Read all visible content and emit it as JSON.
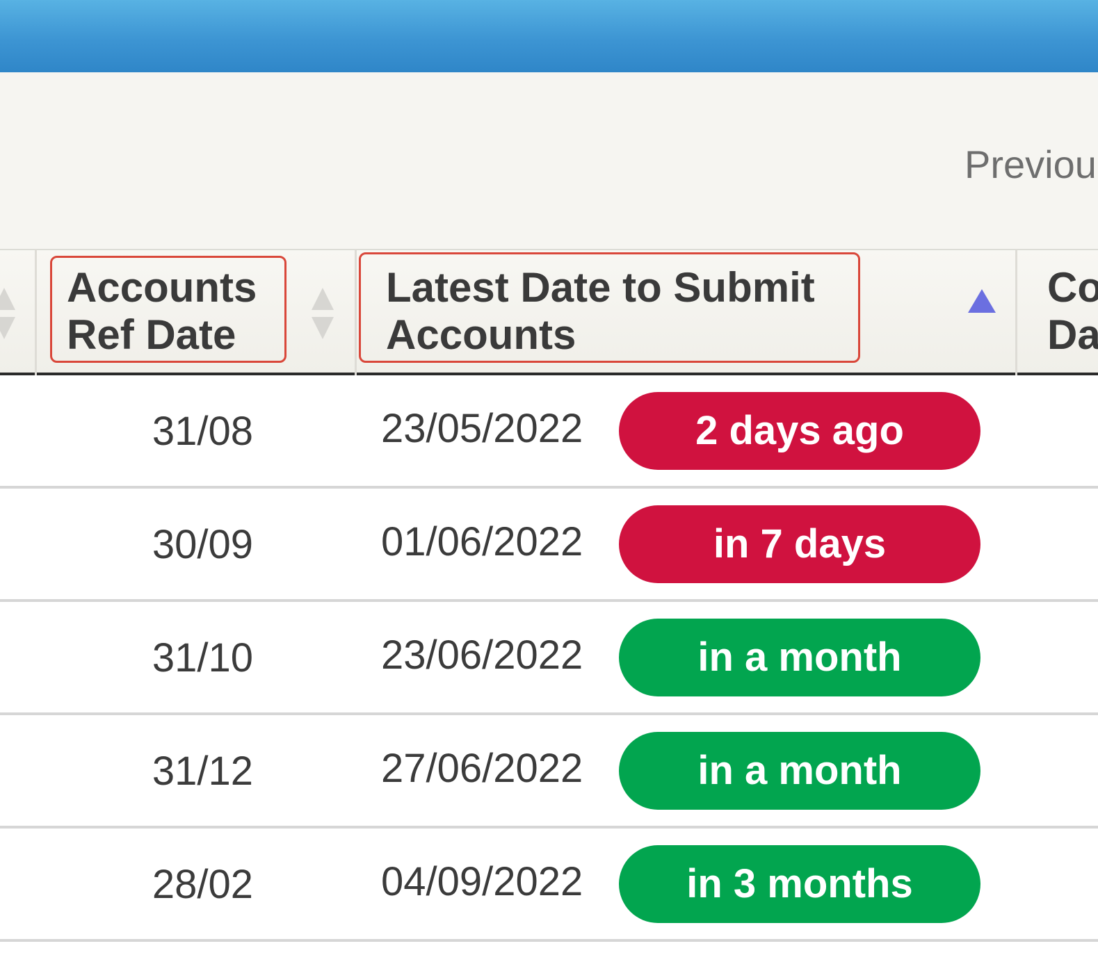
{
  "toolbar": {
    "previous_label": "Previou"
  },
  "columns": {
    "ref_date": [
      "Accounts",
      "Ref Date"
    ],
    "latest_date": [
      "Latest Date to Submit",
      "Accounts"
    ],
    "next": [
      "Co",
      "Da"
    ]
  },
  "colors": {
    "badge_overdue": "#d0123f",
    "badge_ok": "#02a54f",
    "highlight": "#d9473a",
    "sort_active": "#6b6fe0"
  },
  "rows": [
    {
      "ref_date": "31/08",
      "latest_date": "23/05/2022",
      "badge": "2 days ago",
      "status": "overdue"
    },
    {
      "ref_date": "30/09",
      "latest_date": "01/06/2022",
      "badge": "in 7 days",
      "status": "overdue"
    },
    {
      "ref_date": "31/10",
      "latest_date": "23/06/2022",
      "badge": "in a month",
      "status": "ok"
    },
    {
      "ref_date": "31/12",
      "latest_date": "27/06/2022",
      "badge": "in a month",
      "status": "ok"
    },
    {
      "ref_date": "28/02",
      "latest_date": "04/09/2022",
      "badge": "in 3 months",
      "status": "ok"
    }
  ]
}
